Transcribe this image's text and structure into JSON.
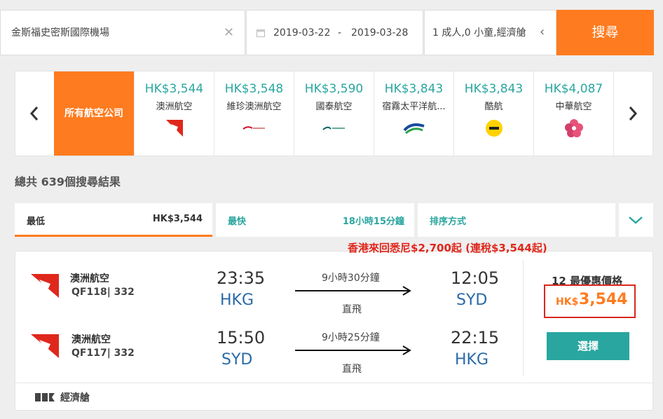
{
  "search": {
    "destination": "金斯福史密斯國際機場",
    "date_from": "2019-03-22",
    "date_sep": "-",
    "date_to": "2019-03-28",
    "passengers": "1 成人,0 小童,經濟艙",
    "search_label": "搜尋"
  },
  "airlines": {
    "all_label": "所有航空公司",
    "items": [
      {
        "price": "HK$3,544",
        "name": "澳洲航空"
      },
      {
        "price": "HK$3,548",
        "name": "維珍澳洲航空"
      },
      {
        "price": "HK$3,590",
        "name": "國泰航空"
      },
      {
        "price": "HK$3,843",
        "name": "宿霧太平洋航..."
      },
      {
        "price": "HK$3,843",
        "name": "酷航"
      },
      {
        "price": "HK$4,087",
        "name": "中華航空"
      }
    ]
  },
  "results": {
    "count_text": "總共 639個搜尋結果"
  },
  "sort": {
    "cheapest_label": "最低",
    "cheapest_value": "HK$3,544",
    "fastest_label": "最快",
    "fastest_value": "18小時15分鐘",
    "sort_label": "排序方式"
  },
  "promo_text": "香港來回悉尼$2,700起 (連稅$3,544起)",
  "flight": {
    "legs": [
      {
        "airline": "澳洲航空",
        "flight_no": "QF118| 332",
        "dep_time": "23:35",
        "dep_code": "HKG",
        "duration": "9小時30分鐘",
        "stops": "直飛",
        "arr_time": "12:05",
        "arr_code": "SYD"
      },
      {
        "airline": "澳洲航空",
        "flight_no": "QF117| 332",
        "dep_time": "15:50",
        "dep_code": "SYD",
        "duration": "9小時25分鐘",
        "stops": "直飛",
        "arr_time": "22:15",
        "arr_code": "HKG"
      }
    ],
    "offers_text": "12 最優惠價格",
    "price_currency": "HK$",
    "price_value": "3,544",
    "select_label": "選擇",
    "cabin_label": "經濟艙"
  },
  "colors": {
    "accent": "#ff7b1f",
    "teal": "#2aa6a0",
    "blue": "#2b6aa8",
    "red": "#e0271c"
  }
}
